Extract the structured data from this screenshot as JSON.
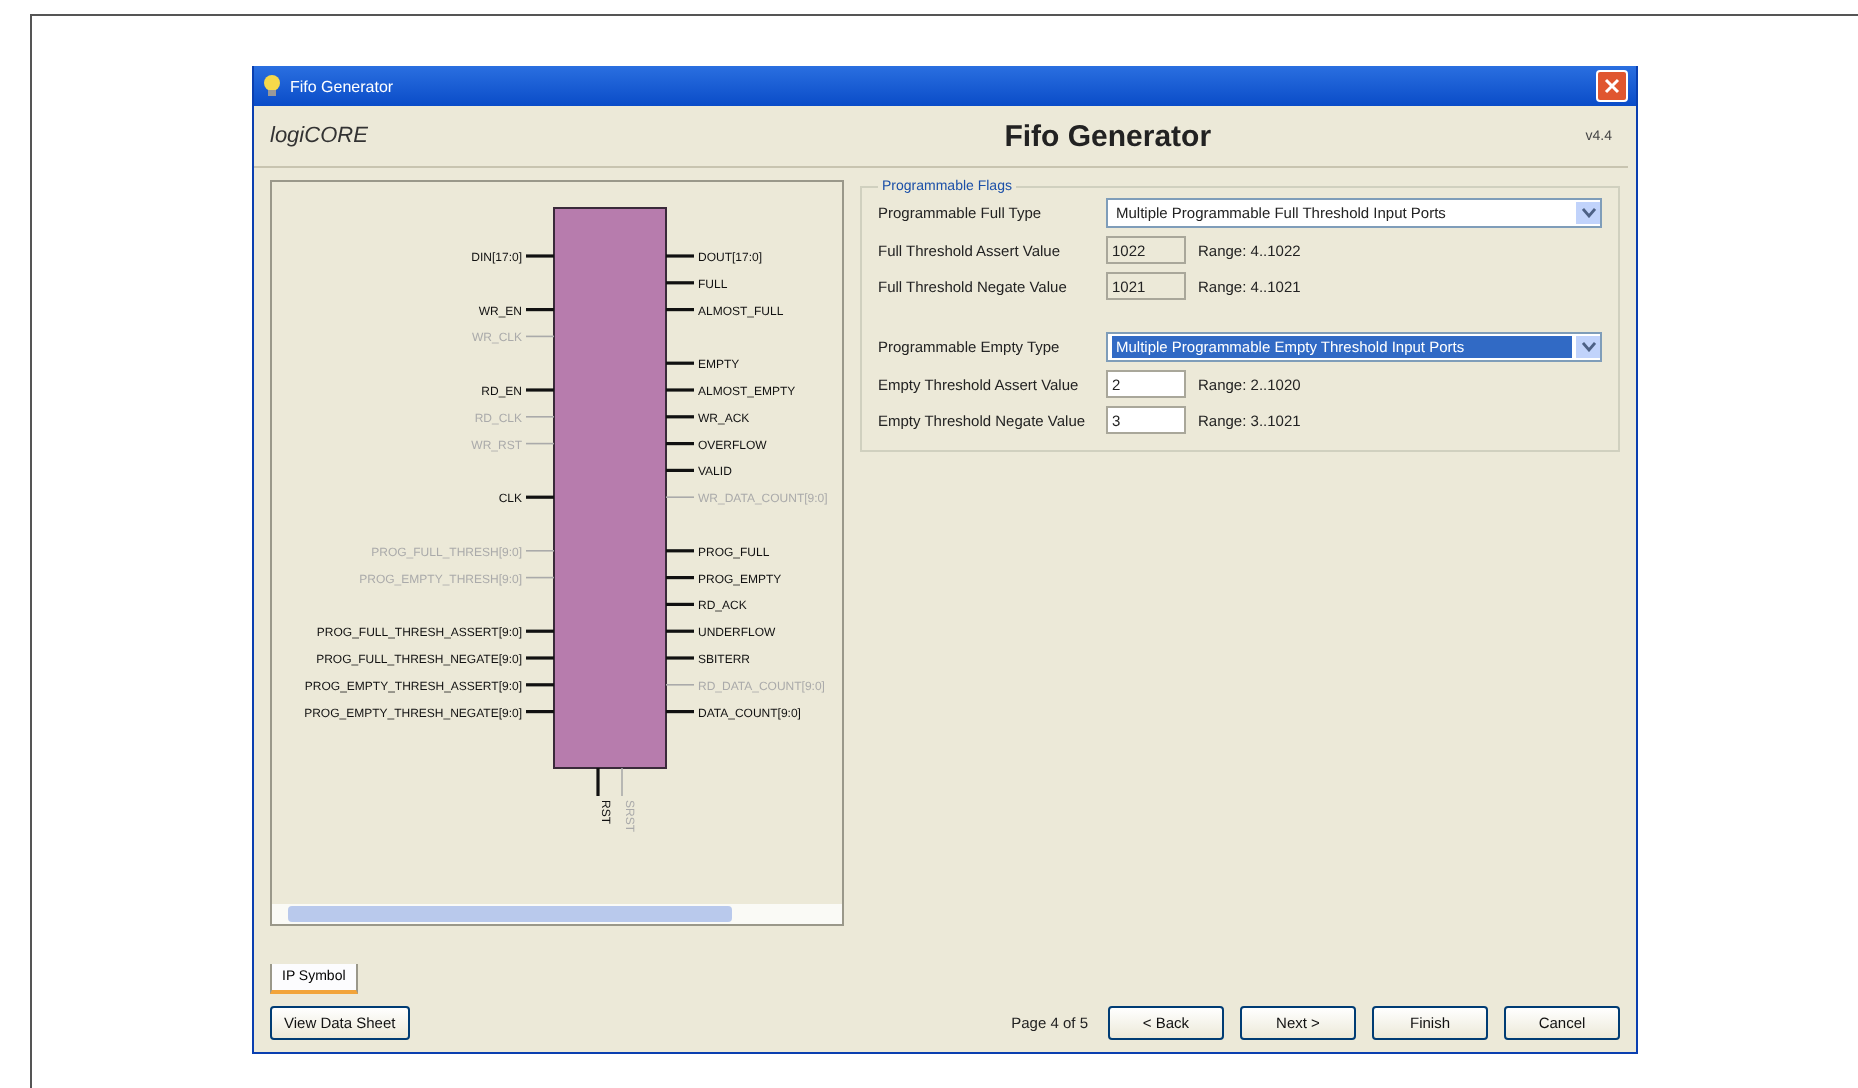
{
  "window": {
    "title": "Fifo Generator"
  },
  "header": {
    "logo": "logiCORE",
    "title": "Fifo Generator",
    "version": "v4.4"
  },
  "symbol": {
    "left_pins": [
      {
        "label": "DIN[17:0]",
        "enabled": true
      },
      {
        "label": "WR_EN",
        "enabled": true
      },
      {
        "label": "WR_CLK",
        "enabled": false
      },
      {
        "label": "RD_EN",
        "enabled": true
      },
      {
        "label": "RD_CLK",
        "enabled": false
      },
      {
        "label": "WR_RST",
        "enabled": false
      },
      {
        "label": "CLK",
        "enabled": true
      },
      {
        "label": "PROG_FULL_THRESH[9:0]",
        "enabled": false
      },
      {
        "label": "PROG_EMPTY_THRESH[9:0]",
        "enabled": false
      },
      {
        "label": "PROG_FULL_THRESH_ASSERT[9:0]",
        "enabled": true
      },
      {
        "label": "PROG_FULL_THRESH_NEGATE[9:0]",
        "enabled": true
      },
      {
        "label": "PROG_EMPTY_THRESH_ASSERT[9:0]",
        "enabled": true
      },
      {
        "label": "PROG_EMPTY_THRESH_NEGATE[9:0]",
        "enabled": true
      }
    ],
    "right_pins": [
      {
        "label": "DOUT[17:0]",
        "enabled": true
      },
      {
        "label": "FULL",
        "enabled": true
      },
      {
        "label": "ALMOST_FULL",
        "enabled": true
      },
      {
        "label": "EMPTY",
        "enabled": true
      },
      {
        "label": "ALMOST_EMPTY",
        "enabled": true
      },
      {
        "label": "WR_ACK",
        "enabled": true
      },
      {
        "label": "OVERFLOW",
        "enabled": true
      },
      {
        "label": "VALID",
        "enabled": true
      },
      {
        "label": "WR_DATA_COUNT[9:0]",
        "enabled": false
      },
      {
        "label": "PROG_FULL",
        "enabled": true
      },
      {
        "label": "PROG_EMPTY",
        "enabled": true
      },
      {
        "label": "RD_ACK",
        "enabled": true
      },
      {
        "label": "UNDERFLOW",
        "enabled": true
      },
      {
        "label": "SBITERR",
        "enabled": true
      },
      {
        "label": "RD_DATA_COUNT[9:0]",
        "enabled": false
      },
      {
        "label": "DATA_COUNT[9:0]",
        "enabled": true
      }
    ],
    "bottom_pins": [
      {
        "label": "RST",
        "enabled": true
      },
      {
        "label": "SRST",
        "enabled": false
      }
    ]
  },
  "tabs": [
    {
      "label": "IP Symbol",
      "selected": true
    }
  ],
  "flags": {
    "title": "Programmable Flags",
    "rows": [
      {
        "kind": "select",
        "label": "Programmable Full Type",
        "value": "Multiple Programmable Full Threshold Input Ports",
        "focused": false
      },
      {
        "kind": "number",
        "label": "Full Threshold Assert Value",
        "value": "1022",
        "range": "Range: 4..1022"
      },
      {
        "kind": "number",
        "label": "Full Threshold Negate Value",
        "value": "1021",
        "range": "Range: 4..1021"
      },
      {
        "kind": "select",
        "label": "Programmable Empty Type",
        "value": "Multiple Programmable Empty Threshold Input Ports",
        "focused": true
      },
      {
        "kind": "number",
        "label": "Empty Threshold Assert Value",
        "value": "2",
        "range": "Range: 2..1020"
      },
      {
        "kind": "number",
        "label": "Empty Threshold Negate Value",
        "value": "3",
        "range": "Range: 3..1021"
      }
    ]
  },
  "datasheet_button": "View Data Sheet",
  "page_indicator": "Page 4 of 5",
  "buttons": [
    "< Back",
    "Next >",
    "Finish",
    "Cancel"
  ]
}
